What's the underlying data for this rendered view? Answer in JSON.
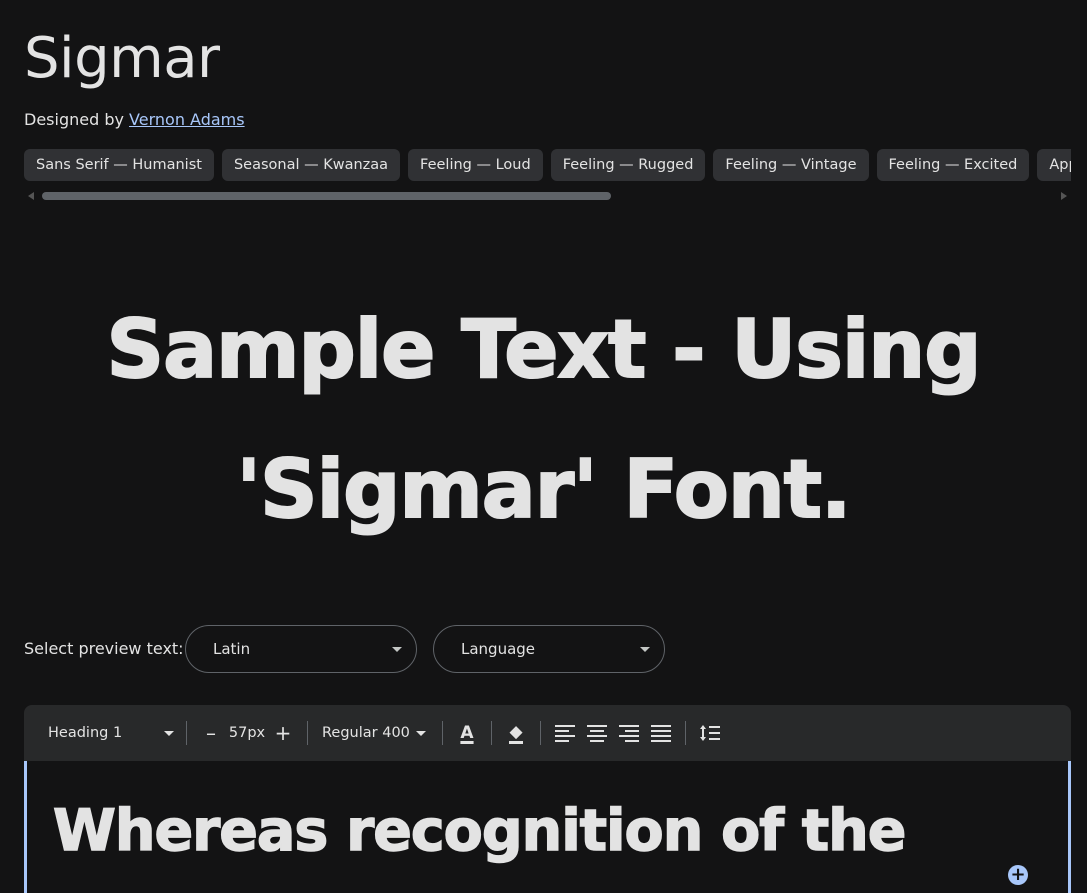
{
  "font": {
    "name": "Sigmar",
    "designed_by_prefix": "Designed by",
    "designer": "Vernon Adams"
  },
  "tags": [
    "Sans Serif — Humanist",
    "Seasonal — Kwanzaa",
    "Feeling — Loud",
    "Feeling — Rugged",
    "Feeling — Vintage",
    "Feeling — Excited",
    "Appearance"
  ],
  "sample": {
    "line1": "Sample Text - Using",
    "line2": "'Sigmar' Font."
  },
  "preview": {
    "label": "Select preview text:",
    "script": "Latin",
    "language": "Language"
  },
  "toolbar": {
    "style": "Heading 1",
    "decrease": "–",
    "size": "57px",
    "increase": "+",
    "weight": "Regular 400"
  },
  "editor": {
    "text": "Whereas recognition of the"
  },
  "colors": {
    "background": "#131314",
    "link": "#a8c7fa",
    "chip": "#303134",
    "toolbar": "#28292a"
  }
}
